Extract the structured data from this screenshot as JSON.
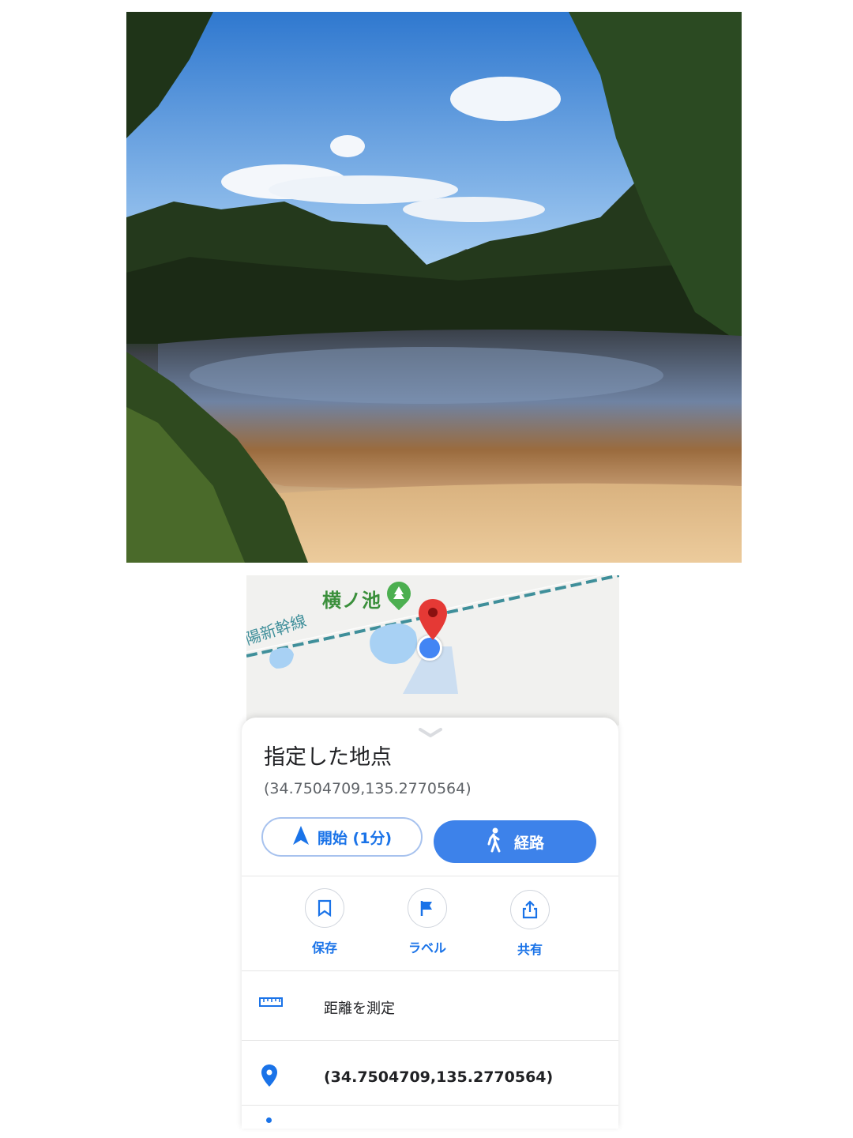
{
  "map": {
    "place_label": "横ノ池",
    "rail_label": "陽新幹線",
    "colors": {
      "water": "#9fcdf5",
      "pin": "#e53935",
      "location_dot": "#4285f4",
      "rail": "#4a9aa3"
    }
  },
  "place": {
    "title": "指定した地点",
    "coordinates": "(34.7504709,135.2770564)"
  },
  "buttons": {
    "start_label": "開始 (1分)",
    "route_label": "経路"
  },
  "actions": [
    {
      "label": "保存",
      "icon": "bookmark-icon"
    },
    {
      "label": "ラベル",
      "icon": "flag-icon"
    },
    {
      "label": "共有",
      "icon": "share-icon"
    }
  ],
  "rows": [
    {
      "label": "距離を測定",
      "icon": "ruler-icon"
    },
    {
      "label": "(34.7504709,135.2770564)",
      "icon": "location-pin-icon"
    }
  ]
}
